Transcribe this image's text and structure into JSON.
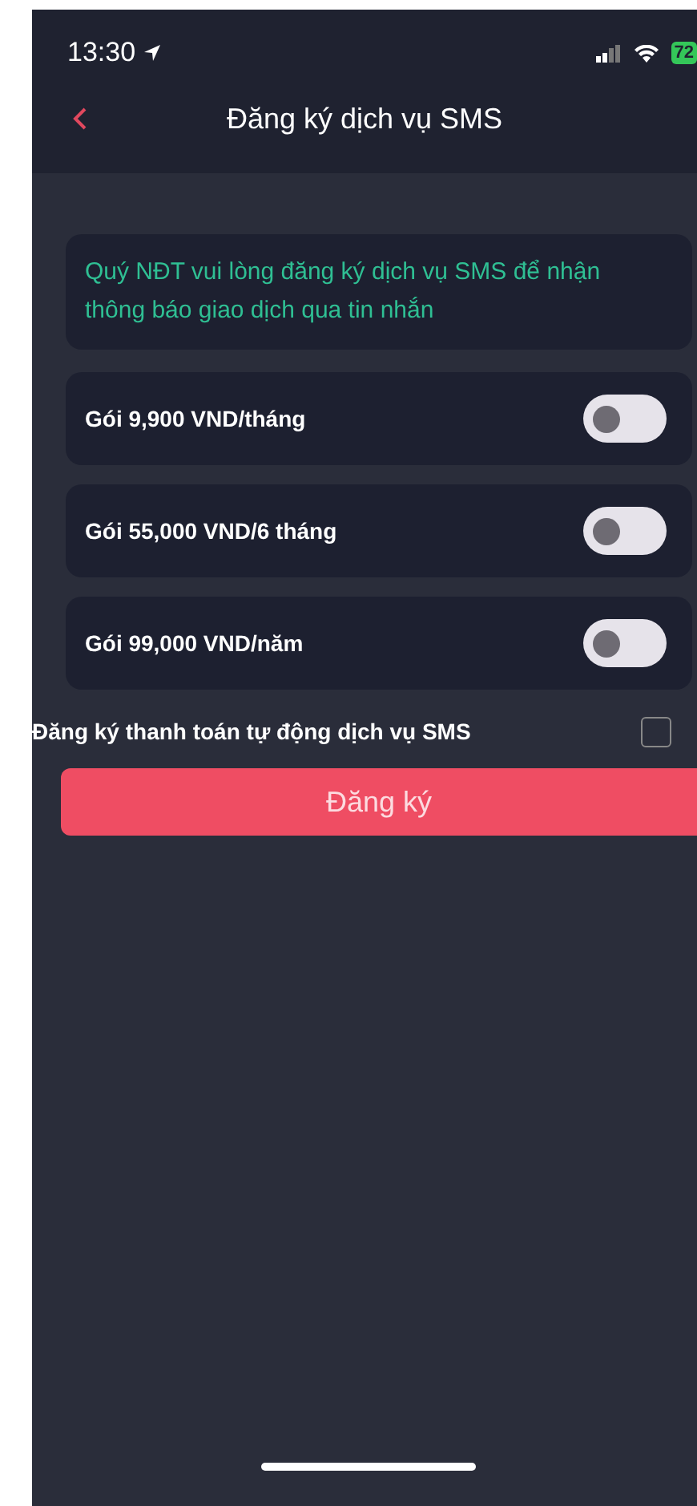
{
  "status_bar": {
    "time": "13:30",
    "battery": "72"
  },
  "nav": {
    "title": "Đăng ký dịch vụ SMS"
  },
  "notice": "Quý NĐT vui lòng đăng ký dịch vụ SMS để nhận thông báo giao dịch qua tin nhắn",
  "packages": [
    {
      "label": "Gói 9,900 VND/tháng",
      "on": false
    },
    {
      "label": "Gói 55,000 VND/6 tháng",
      "on": false
    },
    {
      "label": "Gói 99,000 VND/năm",
      "on": false
    }
  ],
  "auto_pay": {
    "label": "Đăng ký thanh toán tự động dịch vụ SMS",
    "checked": false
  },
  "submit": "Đăng ký"
}
